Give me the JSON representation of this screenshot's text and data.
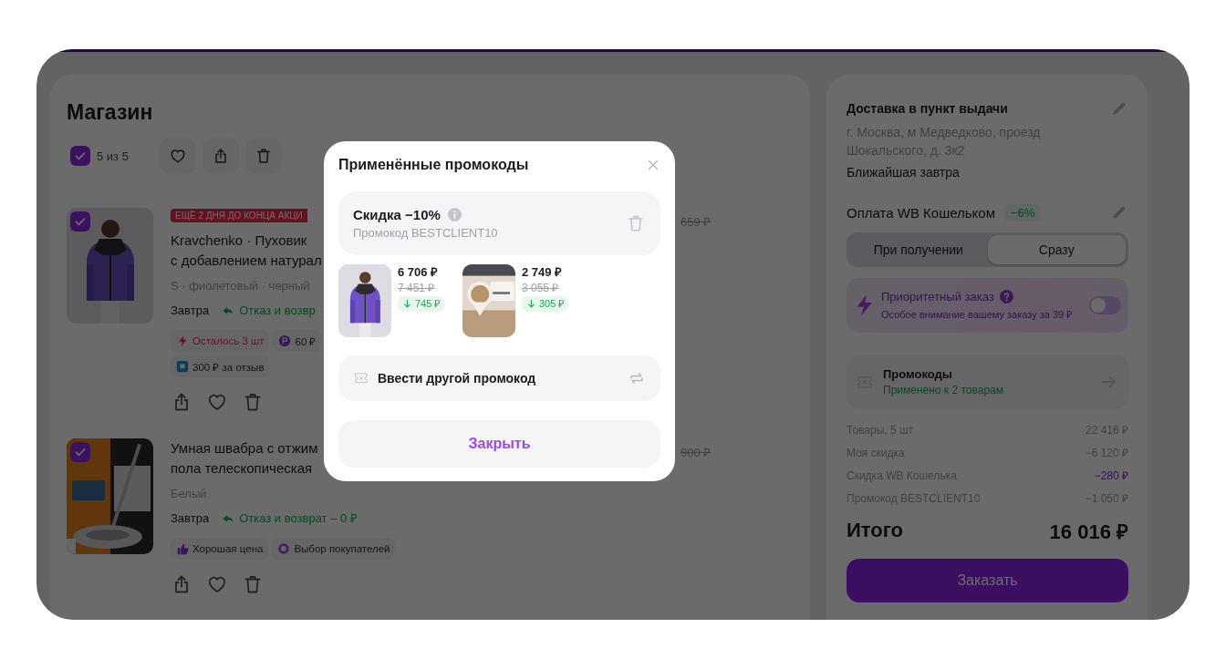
{
  "cart": {
    "title": "Магазин",
    "select_all": {
      "checked": true,
      "label": "5 из 5"
    },
    "items": [
      {
        "checked": true,
        "badge": "ЕЩЁ 2 ДНЯ ДО КОНЦА АКЦИ",
        "title_lines": [
          "Kravchenko · Пуховик",
          "с добавлением натурал"
        ],
        "variant": "S · фиолетовый · черный",
        "delivery": "Завтра",
        "return_note": "Отказ и возвр",
        "tag_rows": [
          [
            {
              "kind": "stock",
              "label": "Осталось 3 шт"
            },
            {
              "kind": "coins",
              "label": "60 ₽"
            }
          ],
          [
            {
              "kind": "review",
              "label": "300 ₽ за отзыв"
            }
          ]
        ],
        "old_price": "659 ₽",
        "image": {
          "kind": "picture"
        }
      },
      {
        "checked": true,
        "title_lines": [
          "Умная швабра с отжим",
          "пола телескопическая"
        ],
        "variant": "Белый",
        "delivery": "Завтра",
        "return_note": "Отказ и возврат – 0 ₽",
        "tag_rows": [
          [
            {
              "kind": "good_price",
              "label": "Хорошая цена"
            },
            {
              "kind": "choice",
              "label": "Выбор покупателей"
            }
          ]
        ],
        "old_price": "900 ₽",
        "image": {
          "kind": "picture"
        }
      }
    ]
  },
  "order": {
    "delivery": {
      "title": "Доставка в пункт выдачи",
      "address": "г. Москва, м Медведково, проезд Шокальского, д. 3к2",
      "eta": "Ближайшая завтра"
    },
    "payment": {
      "title": "Оплата WB Кошельком",
      "badge": "−6%",
      "options": [
        {
          "label": "При получении",
          "selected": false
        },
        {
          "label": "Сразу",
          "selected": true
        }
      ]
    },
    "priority": {
      "title": "Приоритетный заказ",
      "subtitle": "Особое внимание вашему заказу за 39 ₽",
      "on": false
    },
    "promo": {
      "title": "Промокоды",
      "status": "Применено к 2 товарам"
    },
    "summary": [
      {
        "label": "Товары, 5 шт",
        "value": "22 416 ₽",
        "highlight": false
      },
      {
        "label": "Моя скидка",
        "value": "−6 120 ₽",
        "highlight": false
      },
      {
        "label": "Скидка WB Кошелька",
        "value": "−280 ₽",
        "highlight": true
      },
      {
        "label": "Промокод BESTCLIENT10",
        "value": "−1 050 ₽",
        "highlight": false
      }
    ],
    "total": {
      "label": "Итого",
      "value": "16 016 ₽"
    },
    "order_button": "Заказать"
  },
  "modal": {
    "title": "Применённые промокоды",
    "promo": {
      "title": "Скидка −10%",
      "code": "Промокод BESTCLIENT10"
    },
    "products": [
      {
        "image": {
          "kind": "picture"
        },
        "price": "6 706 ₽",
        "old_price": "7 451 ₽",
        "saving": "745 ₽"
      },
      {
        "image": {
          "kind": "picture"
        },
        "price": "2 749 ₽",
        "old_price": "3 055 ₽",
        "saving": "305 ₽"
      }
    ],
    "other_code": "Ввести другой промокод",
    "close_button": "Закрыть"
  }
}
